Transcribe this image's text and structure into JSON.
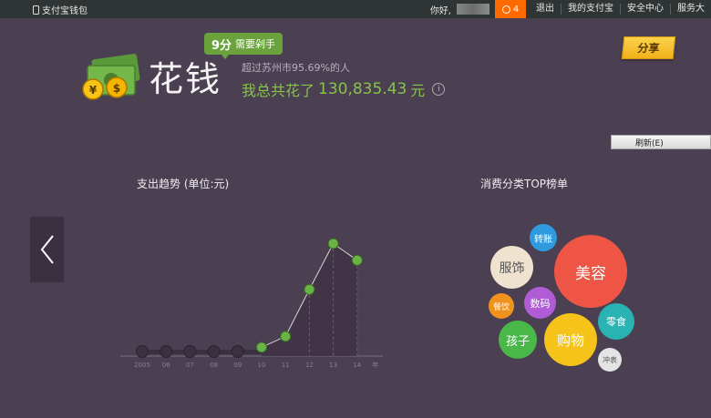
{
  "topbar": {
    "wallet_label": "支付宝钱包",
    "greeting": "你好,",
    "alarm_count": "4",
    "links": [
      "退出",
      "我的支付宝",
      "安全中心",
      "服务大"
    ]
  },
  "header": {
    "title": "花钱",
    "badge_score": "9分",
    "badge_label": "需要剁手",
    "beat_text": "超过苏州市95.69%的人",
    "total_prefix": "我总共花了",
    "total_amount": "130,835.43",
    "total_unit": "元",
    "info_glyph": "i"
  },
  "actions": {
    "share_label": "分享",
    "refresh_label": "刷新(E)"
  },
  "trend": {
    "title": "支出趋势 (单位:元)"
  },
  "top_categories": {
    "title": "消费分类TOP榜单",
    "bubbles": [
      {
        "label": "美容",
        "color": "#ee5544"
      },
      {
        "label": "服饰",
        "color": "#efe3cf"
      },
      {
        "label": "转账",
        "color": "#2e9be0"
      },
      {
        "label": "数码",
        "color": "#b05cd6"
      },
      {
        "label": "餐饮",
        "color": "#f0921e"
      },
      {
        "label": "孩子",
        "color": "#4ab848"
      },
      {
        "label": "购物",
        "color": "#f6c31a"
      },
      {
        "label": "零食",
        "color": "#2ab3b3"
      },
      {
        "label": "冲表",
        "color": "#e4e4e4"
      }
    ]
  },
  "chart_data": {
    "type": "line",
    "categories": [
      "2005",
      "06",
      "07",
      "08",
      "09",
      "10",
      "11",
      "12",
      "13",
      "14"
    ],
    "x_extra_label": "年",
    "values": [
      0,
      0,
      0,
      0,
      0,
      300,
      5500,
      28000,
      50000,
      42000
    ],
    "ylim": [
      0,
      55000
    ],
    "grid": false,
    "colors": {
      "point": "#6ab446",
      "inactive_point": "#3a3140",
      "line": "#d8d8d8",
      "area": "#3f3446"
    }
  }
}
